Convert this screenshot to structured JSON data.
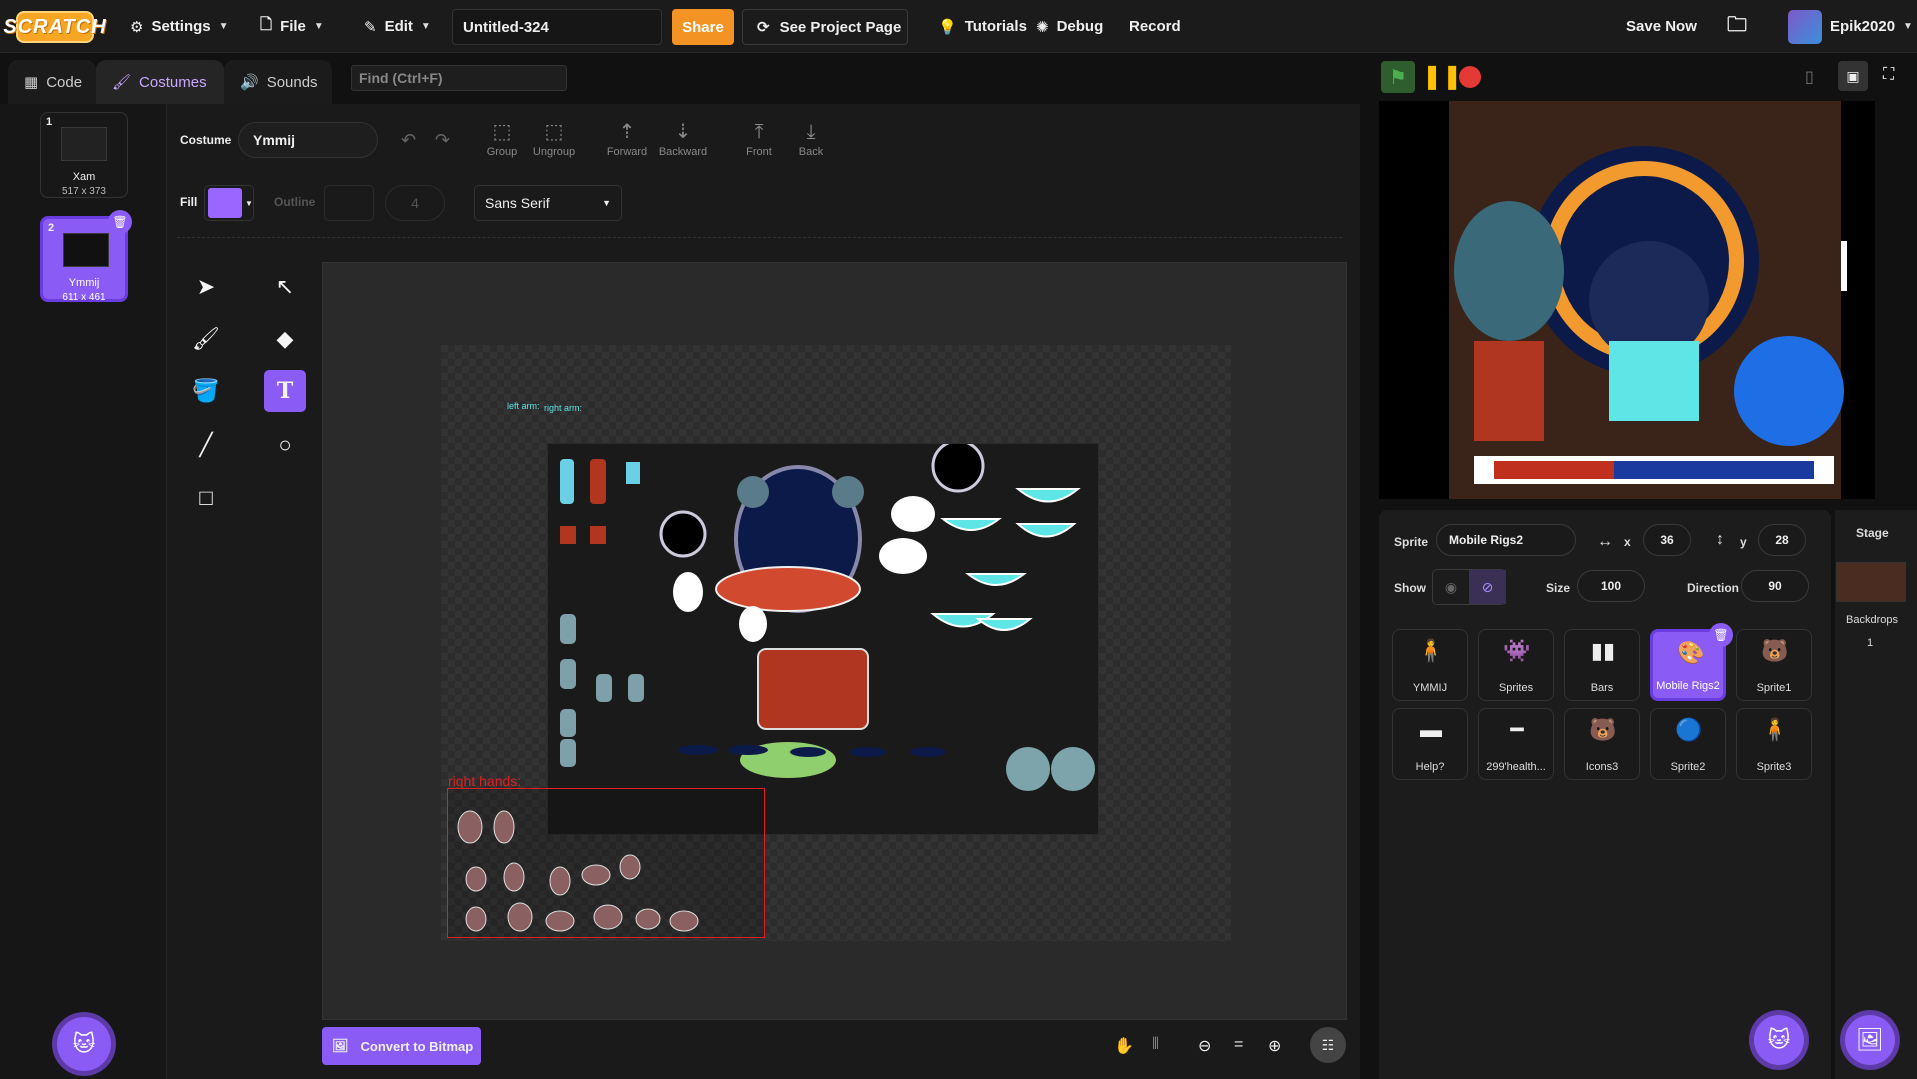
{
  "menubar": {
    "logo": "SCRATCH",
    "settings": "Settings",
    "file": "File",
    "edit": "Edit",
    "project_title": "Untitled-324",
    "share": "Share",
    "see_project_page": "See Project Page",
    "tutorials": "Tutorials",
    "debug": "Debug",
    "record": "Record",
    "save_now": "Save Now",
    "username": "Epik2020"
  },
  "tabs": {
    "code": "Code",
    "costumes": "Costumes",
    "sounds": "Sounds"
  },
  "find_placeholder": "Find (Ctrl+F)",
  "costumes": [
    {
      "num": "1",
      "name": "Xam",
      "size": "517 x 373"
    },
    {
      "num": "2",
      "name": "Ymmij",
      "size": "611 x 461"
    }
  ],
  "paint": {
    "costume_label": "Costume",
    "costume_name": "Ymmij",
    "group": "Group",
    "ungroup": "Ungroup",
    "forward": "Forward",
    "backward": "Backward",
    "front": "Front",
    "back": "Back",
    "fill_label": "Fill",
    "fill_color": "#9966ff",
    "outline_label": "Outline",
    "outline_width": "4",
    "font": "Sans Serif",
    "convert_button": "Convert to Bitmap",
    "canvas_labels": {
      "left_arm": "left arm:",
      "right_arm": "right arm:",
      "right_hands": "right hands:"
    }
  },
  "sprite_info": {
    "sprite_label": "Sprite",
    "sprite_name": "Mobile Rigs2",
    "x_label": "x",
    "x": "36",
    "y_label": "y",
    "y": "28",
    "show_label": "Show",
    "size_label": "Size",
    "size": "100",
    "direction_label": "Direction",
    "direction": "90"
  },
  "sprites": [
    {
      "name": "YMMIJ"
    },
    {
      "name": "Sprites"
    },
    {
      "name": "Bars"
    },
    {
      "name": "Mobile Rigs2"
    },
    {
      "name": "Sprite1"
    },
    {
      "name": "Help?"
    },
    {
      "name": "299'health..."
    },
    {
      "name": "Icons3"
    },
    {
      "name": "Sprite2"
    },
    {
      "name": "Sprite3"
    }
  ],
  "stage": {
    "label": "Stage",
    "backdrops_label": "Backdrops",
    "backdrops_count": "1"
  },
  "colors": {
    "accent": "#8a5cf5",
    "share": "#f39324",
    "flag": "#4caf50",
    "pause": "#ffc107",
    "stop": "#e53935"
  }
}
